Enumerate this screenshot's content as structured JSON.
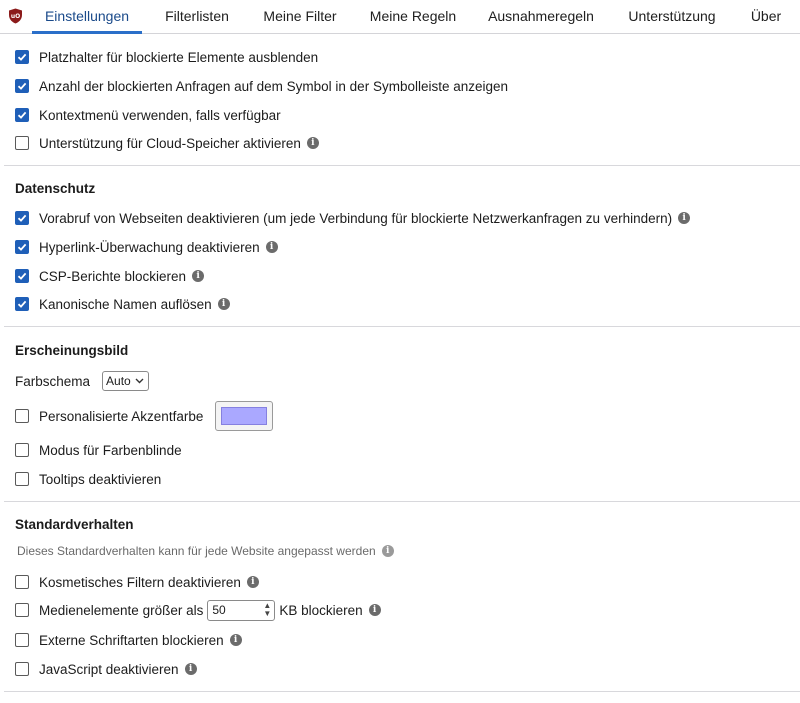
{
  "tabs": [
    {
      "label": "Einstellungen",
      "active": true
    },
    {
      "label": "Filterlisten",
      "active": false
    },
    {
      "label": "Meine Filter",
      "active": false
    },
    {
      "label": "Meine Regeln",
      "active": false
    },
    {
      "label": "Ausnahmeregeln",
      "active": false
    },
    {
      "label": "Unterstützung",
      "active": false
    },
    {
      "label": "Über",
      "active": false
    }
  ],
  "general": {
    "items": [
      {
        "label": "Platzhalter für blockierte Elemente ausblenden",
        "checked": true,
        "info": false
      },
      {
        "label": "Anzahl der blockierten Anfragen auf dem Symbol in der Symbolleiste anzeigen",
        "checked": true,
        "info": false
      },
      {
        "label": "Kontextmenü verwenden, falls verfügbar",
        "checked": true,
        "info": false
      },
      {
        "label": "Unterstützung für Cloud-Speicher aktivieren",
        "checked": false,
        "info": true
      }
    ]
  },
  "privacy": {
    "heading": "Datenschutz",
    "items": [
      {
        "label": "Vorabruf von Webseiten deaktivieren (um jede Verbindung für blockierte Netzwerkanfragen zu verhindern)",
        "checked": true,
        "info": true
      },
      {
        "label": "Hyperlink-Überwachung deaktivieren",
        "checked": true,
        "info": true
      },
      {
        "label": "CSP-Berichte blockieren",
        "checked": true,
        "info": true
      },
      {
        "label": "Kanonische Namen auflösen",
        "checked": true,
        "info": true
      }
    ]
  },
  "appearance": {
    "heading": "Erscheinungsbild",
    "color_scheme_label": "Farbschema",
    "color_scheme_value": "Auto",
    "accent_label": "Personalisierte Akzentfarbe",
    "accent_checked": false,
    "accent_color": "#aaa8ff",
    "colorblind_label": "Modus für Farbenblinde",
    "colorblind_checked": false,
    "tooltips_label": "Tooltips deaktivieren",
    "tooltips_checked": false
  },
  "defaults": {
    "heading": "Standardverhalten",
    "note": "Dieses Standardverhalten kann für jede Website angepasst werden",
    "cosmetic_label": "Kosmetisches Filtern deaktivieren",
    "cosmetic_checked": false,
    "media_label_before": "Medienelemente größer als",
    "media_value": "50",
    "media_label_after": "KB blockieren",
    "media_checked": false,
    "fonts_label": "Externe Schriftarten blockieren",
    "fonts_checked": false,
    "js_label": "JavaScript deaktivieren",
    "js_checked": false
  },
  "colors": {
    "accent_tab": "#2a6fc9",
    "checkbox_checked": "#1f5fb8"
  },
  "icons": {
    "logo": "ublock-shield-icon",
    "info": "info-icon",
    "checkmark": "checkmark-icon",
    "dropdown": "chevron-down-icon",
    "spinner": "spinner-arrows-icon"
  }
}
